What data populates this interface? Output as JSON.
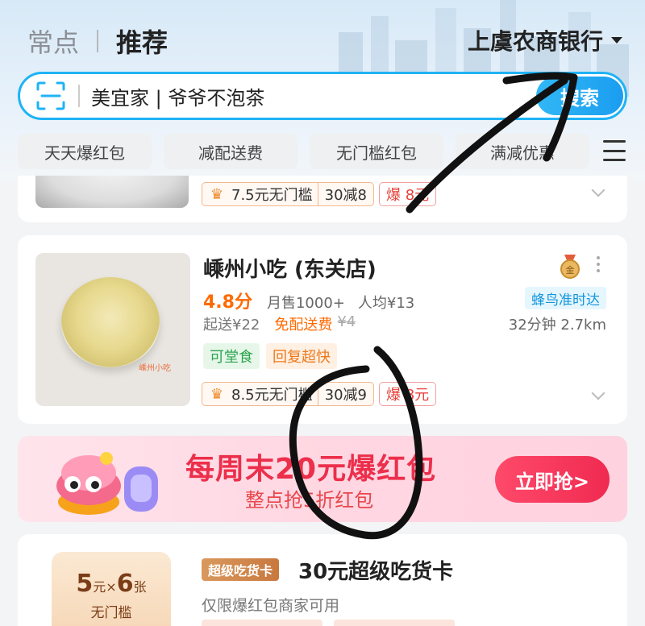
{
  "header": {
    "tab_inactive": "常点",
    "tab_active": "推荐",
    "location": "上虞农商银行"
  },
  "search": {
    "text": "美宜家 | 爷爷不泡茶",
    "button_label": "搜索"
  },
  "filters": [
    "天天爆红包",
    "减配送费",
    "无门槛红包",
    "满减优惠"
  ],
  "prev_card": {
    "promo_main": "7.5元无门槛",
    "promo_sub": "30减8",
    "promo_red": "爆 8元"
  },
  "store": {
    "thumb_label": "嵊州小吃",
    "name": "嵊州小吃 (东关店)",
    "medal_text": "金",
    "rating": "4.8分",
    "monthly_sales": "月售1000+",
    "avg_price": "人均¥13",
    "delivery_badge": "蜂鸟准时达",
    "min_order": "起送¥22",
    "free_delivery": "免配送费",
    "original_fee": "¥4",
    "eta": "32分钟 2.7km",
    "tags": [
      "可堂食",
      "回复超快"
    ],
    "promo_main": "8.5元无门槛",
    "promo_sub": "30减9",
    "promo_red": "爆 8元"
  },
  "banner": {
    "title": "每周末20元爆红包",
    "subtitle": "整点抢5折红包",
    "button_label": "立即抢>"
  },
  "coupon_card": {
    "box_main_a": "5",
    "box_main_unit": "元",
    "box_times": "×",
    "box_main_b": "6",
    "box_count_unit": "张",
    "box_sub": "无门槛",
    "badge": "超级吃货卡",
    "title": "30元超级吃货卡",
    "description": "仅限爆红包商家可用"
  },
  "colors": {
    "brand_blue": "#1fb3f5",
    "rating_orange": "#ff6a00",
    "banner_red": "#ec2f4b"
  }
}
